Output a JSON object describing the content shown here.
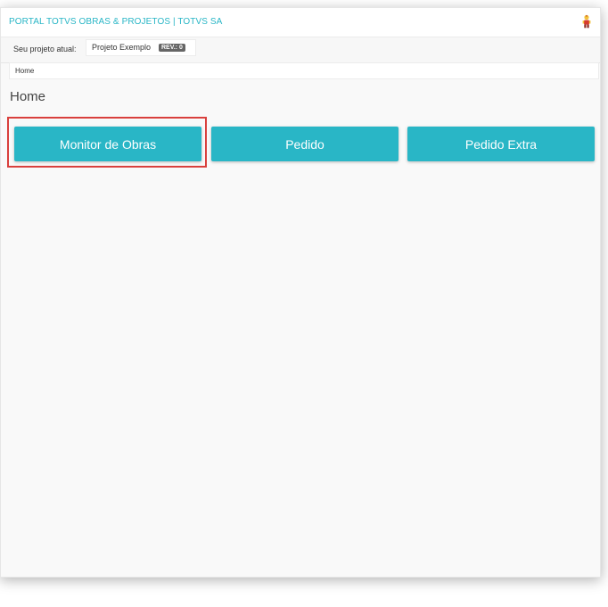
{
  "header": {
    "title": "PORTAL TOTVS OBRAS & PROJETOS | TOTVS SA",
    "user_icon": "user-avatar-icon"
  },
  "project": {
    "label": "Seu projeto atual:",
    "name": "Projeto Exemplo",
    "revision": "REV.: 0"
  },
  "breadcrumb": {
    "items": [
      "Home"
    ]
  },
  "page": {
    "title": "Home"
  },
  "buttons": [
    {
      "label": "Monitor de Obras"
    },
    {
      "label": "Pedido"
    },
    {
      "label": "Pedido Extra"
    }
  ],
  "colors": {
    "accent": "#29b6c6",
    "highlight": "#d9403d"
  }
}
